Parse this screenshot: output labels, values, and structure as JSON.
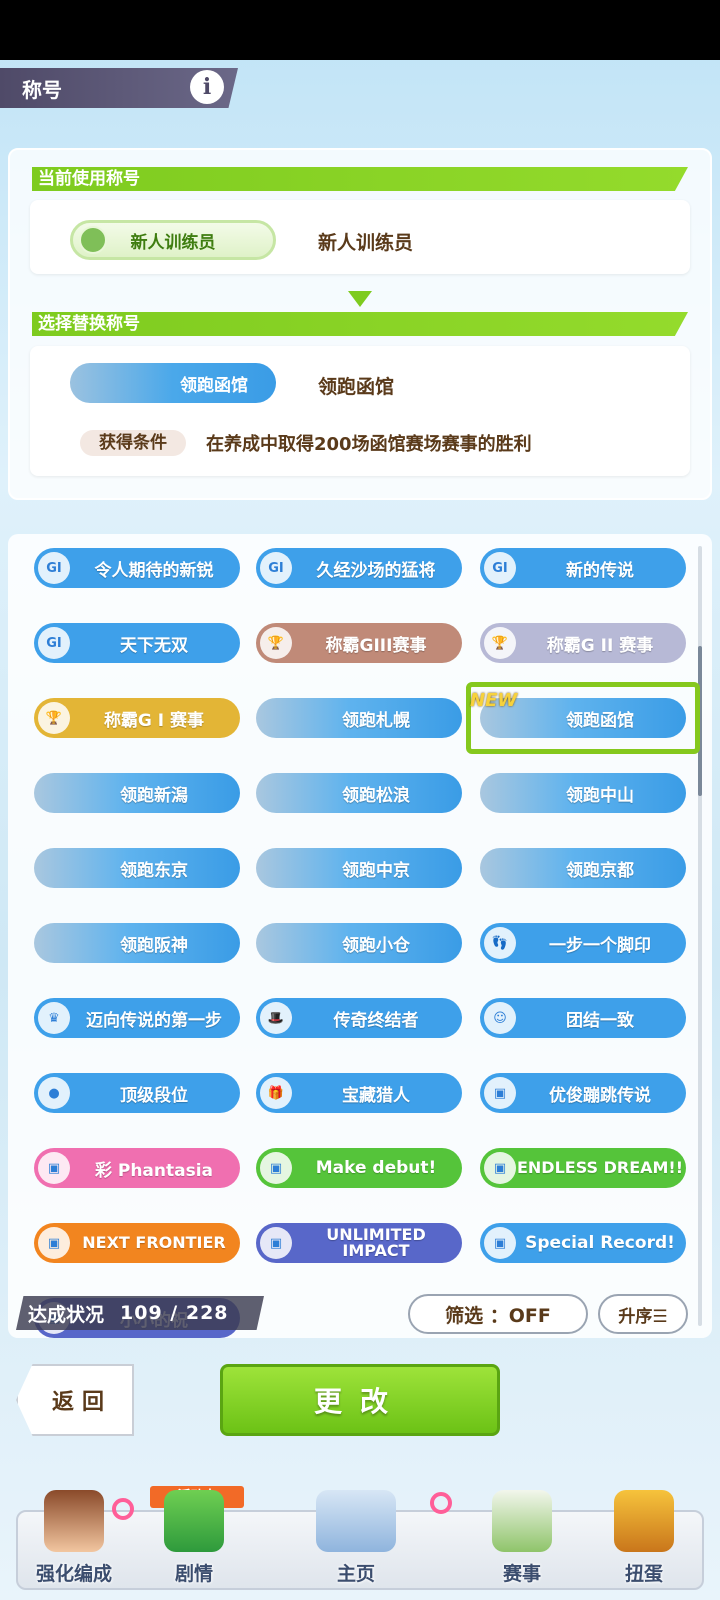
{
  "header": {
    "title": "称号",
    "info_icon": "i"
  },
  "current": {
    "section_title": "当前使用称号",
    "badge_label": "新人训练员",
    "name": "新人训练员"
  },
  "replace": {
    "section_title": "选择替换称号",
    "badge_label": "领跑函馆",
    "name": "领跑函馆",
    "condition_label": "获得条件",
    "condition_text": "在养成中取得200场函馆赛场赛事的胜利"
  },
  "titles": [
    {
      "label": "令人期待的新锐",
      "icon": "GI",
      "color": "#3ea0ea"
    },
    {
      "label": "久经沙场的猛将",
      "icon": "GI",
      "color": "#3ea0ea"
    },
    {
      "label": "新的传说",
      "icon": "GI",
      "color": "#3ea0ea"
    },
    {
      "label": "天下无双",
      "icon": "GI",
      "color": "#3ea0ea"
    },
    {
      "label": "称霸GIII赛事",
      "icon": "trophy",
      "color": "#c08a78"
    },
    {
      "label": "称霸G II 赛事",
      "icon": "trophy",
      "color": "#b7b9d6"
    },
    {
      "label": "称霸G I 赛事",
      "icon": "trophy",
      "color": "#e3b536"
    },
    {
      "label": "领跑札幌",
      "icon": "stadium",
      "color": "#3ea0ea"
    },
    {
      "label": "领跑函馆",
      "icon": "stadium",
      "color": "#3ea0ea"
    },
    {
      "label": "领跑新潟",
      "icon": "stadium",
      "color": "#3ea0ea"
    },
    {
      "label": "领跑松浪",
      "icon": "stadium",
      "color": "#3ea0ea"
    },
    {
      "label": "领跑中山",
      "icon": "stadium",
      "color": "#3ea0ea"
    },
    {
      "label": "领跑东京",
      "icon": "stadium",
      "color": "#3ea0ea"
    },
    {
      "label": "领跑中京",
      "icon": "stadium",
      "color": "#3ea0ea"
    },
    {
      "label": "领跑京都",
      "icon": "stadium",
      "color": "#3ea0ea"
    },
    {
      "label": "领跑阪神",
      "icon": "stadium",
      "color": "#3ea0ea"
    },
    {
      "label": "领跑小仓",
      "icon": "stadium",
      "color": "#3ea0ea"
    },
    {
      "label": "一步一个脚印",
      "icon": "footprint",
      "color": "#3ea0ea"
    },
    {
      "label": "迈向传说的第一步",
      "icon": "crown",
      "color": "#3ea0ea"
    },
    {
      "label": "传奇终结者",
      "icon": "hat",
      "color": "#3ea0ea"
    },
    {
      "label": "团结一致",
      "icon": "team",
      "color": "#3ea0ea"
    },
    {
      "label": "顶级段位",
      "icon": "medal",
      "color": "#3ea0ea"
    },
    {
      "label": "宝藏猎人",
      "icon": "gift",
      "color": "#3ea0ea"
    },
    {
      "label": "优俊蹦跳传说",
      "icon": "card",
      "color": "#3ea0ea"
    },
    {
      "label": "彩 Phantasia",
      "icon": "card",
      "color": "#f06fb0"
    },
    {
      "label": "Make debut!",
      "icon": "card",
      "color": "#55c43a"
    },
    {
      "label": "ENDLESS DREAM!!",
      "icon": "card",
      "color": "#55c43a"
    },
    {
      "label": "NEXT FRONTIER",
      "icon": "card",
      "color": "#f2851f"
    },
    {
      "label": "UNLIMITED IMPACT",
      "icon": "card",
      "color": "#5867c9"
    },
    {
      "label": "Special Record!",
      "icon": "card",
      "color": "#3ea0ea"
    },
    {
      "label": "小小的祝",
      "icon": "card",
      "color": "#5867c9"
    }
  ],
  "status": {
    "label": "达成状况",
    "count": "109 / 228"
  },
  "filter": {
    "label": "筛选 ：OFF"
  },
  "sort": {
    "label": "升序☰"
  },
  "actions": {
    "back": "返回",
    "change": "更改"
  },
  "nav": {
    "event_tag": "活动中",
    "items": [
      "强化编成",
      "剧情",
      "主页",
      "赛事",
      "扭蛋"
    ]
  },
  "colors": {
    "accent_green": "#7ecb1f",
    "title_blue": "#3ea0ea",
    "nav_text": "#3b4d6e"
  }
}
